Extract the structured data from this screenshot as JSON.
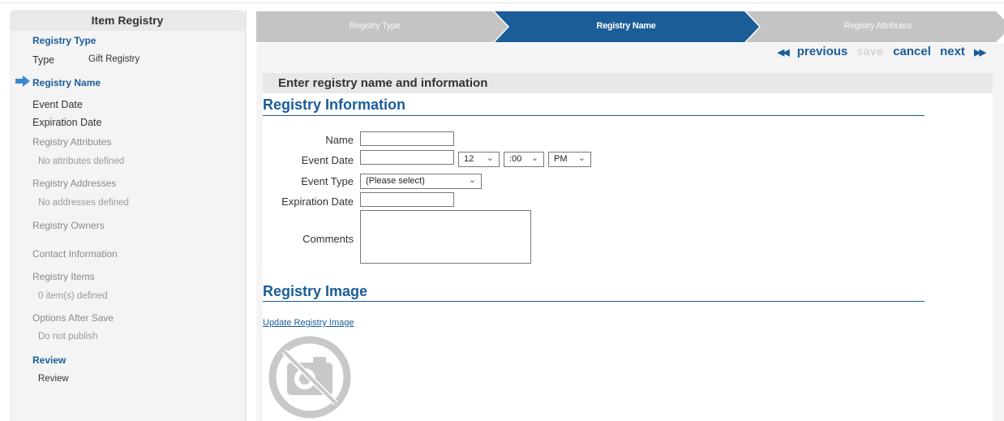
{
  "sidebar": {
    "title": "Item Registry",
    "registry_type_heading": "Registry Type",
    "type_label": "Type",
    "type_value": "Gift Registry",
    "registry_name_heading": "Registry Name",
    "event_date": "Event Date",
    "expiration_date": "Expiration Date",
    "attributes_heading": "Registry Attributes",
    "attributes_sub": "No attributes defined",
    "addresses_heading": "Registry Addresses",
    "addresses_sub": "No addresses defined",
    "owners_heading": "Registry Owners",
    "contact_heading": "Contact Information",
    "items_heading": "Registry Items",
    "items_sub": "0 item(s) defined",
    "options_heading": "Options After Save",
    "options_sub": "Do not publish",
    "review_heading": "Review",
    "review_sub": "Review"
  },
  "steps": {
    "step1": "Registry Type",
    "step2": "Registry Name",
    "step3": "Registry Attributes",
    "active_color": "#1a5d98",
    "inactive_color": "#c4c4c4"
  },
  "nav": {
    "previous": "previous",
    "save": "save",
    "cancel": "cancel",
    "next": "next",
    "prev_icon": "◀◀",
    "next_icon": "▶▶"
  },
  "panel": {
    "heading": "Enter registry name and information",
    "info_title": "Registry Information",
    "name_label": "Name",
    "name_value": "",
    "event_date_label": "Event Date",
    "event_date_value": "",
    "hour": "12",
    "minute": ":00",
    "ampm": "PM",
    "event_type_label": "Event Type",
    "event_type_value": "(Please select)",
    "expiration_label": "Expiration Date",
    "expiration_value": "",
    "comments_label": "Comments",
    "comments_value": "",
    "image_title": "Registry Image",
    "update_image_link": "Update Registry Image",
    "image_icon": "no-camera-icon"
  }
}
